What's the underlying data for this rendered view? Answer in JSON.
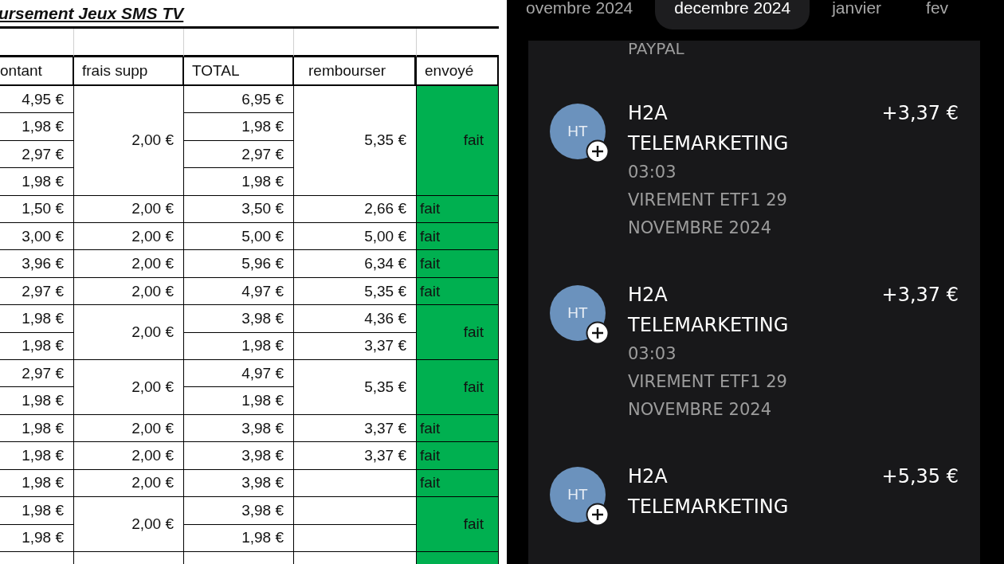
{
  "spreadsheet": {
    "title": "ursement Jeux SMS TV",
    "columns": [
      "ontant",
      "frais supp",
      "TOTAL",
      "rembourser",
      "envoyé"
    ],
    "groups": [
      {
        "lines": [
          {
            "montant": "4,95 €",
            "total": "6,95 €"
          },
          {
            "montant": "1,98 €",
            "total": "1,98 €"
          },
          {
            "montant": "2,97 €",
            "total": "2,97 €"
          },
          {
            "montant": "1,98 €",
            "total": "1,98 €"
          }
        ],
        "frais": "2,00 €",
        "rembourser": "5,35 €",
        "envoye": "fait",
        "done": true
      },
      {
        "lines": [
          {
            "montant": "1,50 €",
            "total": "3,50 €",
            "rembourser": "2,66 €"
          }
        ],
        "frais": "2,00 €",
        "envoye": "fait",
        "done": true
      },
      {
        "lines": [
          {
            "montant": "3,00 €",
            "total": "5,00 €",
            "rembourser": "5,00 €"
          }
        ],
        "frais": "2,00 €",
        "envoye": "fait",
        "done": true
      },
      {
        "lines": [
          {
            "montant": "3,96 €",
            "total": "5,96 €",
            "rembourser": "6,34 €"
          }
        ],
        "frais": "2,00 €",
        "envoye": "fait",
        "done": true
      },
      {
        "lines": [
          {
            "montant": "2,97 €",
            "total": "4,97 €",
            "rembourser": "5,35 €"
          }
        ],
        "frais": "2,00 €",
        "envoye": "fait",
        "done": true
      },
      {
        "lines": [
          {
            "montant": "1,98 €",
            "total": "3,98 €",
            "rembourser": "4,36 €"
          },
          {
            "montant": "1,98 €",
            "total": "1,98 €",
            "rembourser": "3,37 €"
          }
        ],
        "frais": "2,00 €",
        "envoye": "fait",
        "done": true
      },
      {
        "lines": [
          {
            "montant": "2,97 €",
            "total": "4,97 €"
          },
          {
            "montant": "1,98 €",
            "total": "1,98 €"
          }
        ],
        "frais": "2,00 €",
        "rembourser": "5,35 €",
        "envoye": "fait",
        "done": true
      },
      {
        "lines": [
          {
            "montant": "1,98 €",
            "total": "3,98 €",
            "rembourser": "3,37 €"
          }
        ],
        "frais": "2,00 €",
        "envoye": "fait",
        "done": true
      },
      {
        "lines": [
          {
            "montant": "1,98 €",
            "total": "3,98 €",
            "rembourser": "3,37 €"
          }
        ],
        "frais": "2,00 €",
        "envoye": "fait",
        "done": true
      },
      {
        "lines": [
          {
            "montant": "1,98 €",
            "total": "3,98 €"
          }
        ],
        "frais": "2,00 €",
        "envoye": "fait",
        "done": true
      },
      {
        "lines": [
          {
            "montant": "1,98 €",
            "total": "3,98 €"
          },
          {
            "montant": "1,98 €",
            "total": "1,98 €"
          }
        ],
        "frais": "2,00 €",
        "envoye": "fait",
        "done": true
      }
    ],
    "partial_row": {
      "done": true
    }
  },
  "bank_app": {
    "month_tabs": [
      {
        "label": "ovembre 2024",
        "selected": false
      },
      {
        "label": "decembre 2024",
        "selected": true
      },
      {
        "label": "janvier",
        "selected": false
      },
      {
        "label": "fev",
        "selected": false
      }
    ],
    "previous_description": "PAYPAL",
    "transactions": [
      {
        "initials": "HT",
        "name": "H2A TELEMARKETING",
        "amount": "+3,37 €",
        "time": "03:03",
        "description": "VIREMENT ETF1 29 NOVEMBRE 2024"
      },
      {
        "initials": "HT",
        "name": "H2A TELEMARKETING",
        "amount": "+3,37 €",
        "time": "03:03",
        "description": "VIREMENT ETF1 29 NOVEMBRE 2024"
      },
      {
        "initials": "HT",
        "name": "H2A TELEMARKETING",
        "amount": "+5,35 €"
      }
    ]
  }
}
